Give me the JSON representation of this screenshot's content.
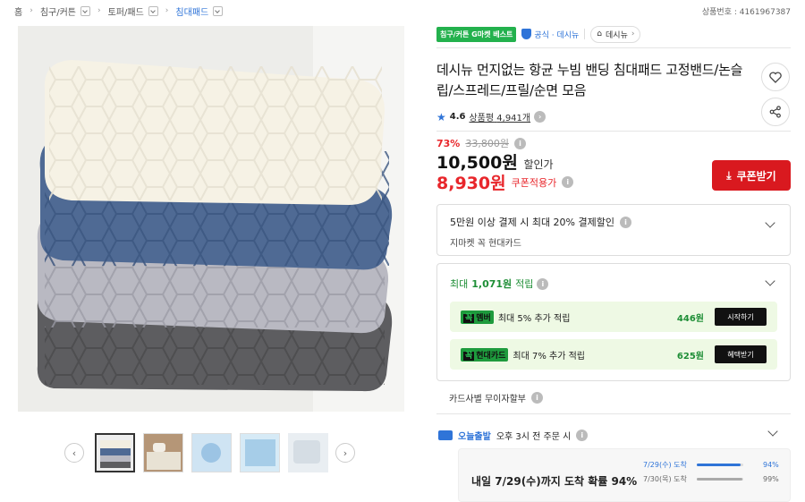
{
  "breadcrumb": {
    "home": "홈",
    "cat1": "침구/커튼",
    "cat2": "토퍼/패드",
    "cat3": "침대패드"
  },
  "product_no": "상품번호 : 4161967387",
  "badges": {
    "category_best": "침구/커튼 G마켓 베스트",
    "official": "공식 · 데시뉴",
    "store": "데시뉴"
  },
  "title": "데시뉴 먼지없는 항균 누빔 밴딩 침대패드 고정밴드/논슬립/스프레드/프릴/순면 모음",
  "rating": {
    "score": "4.6",
    "review_label": "상품평",
    "review_count": "4,941개"
  },
  "price": {
    "discount": "73%",
    "original": "33,800원",
    "sale": "10,500원",
    "sale_suffix": "할인가",
    "coupon_price": "8,930원",
    "coupon_suffix": "쿠폰적용가"
  },
  "coupon_button": "쿠폰받기",
  "card_promo": {
    "title": "5만원 이상 결제 시 최대 20% 결제할인",
    "subtitle": "지마켓 꼭 현대카드"
  },
  "points": {
    "label": "최대",
    "amount": "1,071원",
    "suffix": "적립",
    "rows": [
      {
        "badge_k": "꼭",
        "badge": "멤버",
        "text": "최대 5% 추가 적립",
        "value": "446원",
        "button": "시작하기"
      },
      {
        "badge_k": "꼭",
        "badge": "현대카드",
        "text": "최대 7% 추가 적립",
        "value": "625원",
        "button": "혜택받기"
      }
    ]
  },
  "installment": "카드사별 무이자할부",
  "delivery": {
    "label": "오늘출발",
    "text": "오후 3시 전 주문 시",
    "headline": "내일 7/29(수)까지 도착 확률 94%",
    "stats": [
      {
        "date": "7/29(수) 도착",
        "pct": "94%",
        "value": 0.94
      },
      {
        "date": "7/30(목) 도착",
        "pct": "99%",
        "value": 0.99
      }
    ]
  },
  "colors": {
    "accent_red": "#d9191f",
    "price_red": "#e8262b",
    "green": "#23b14d",
    "blue": "#2f74d8"
  }
}
